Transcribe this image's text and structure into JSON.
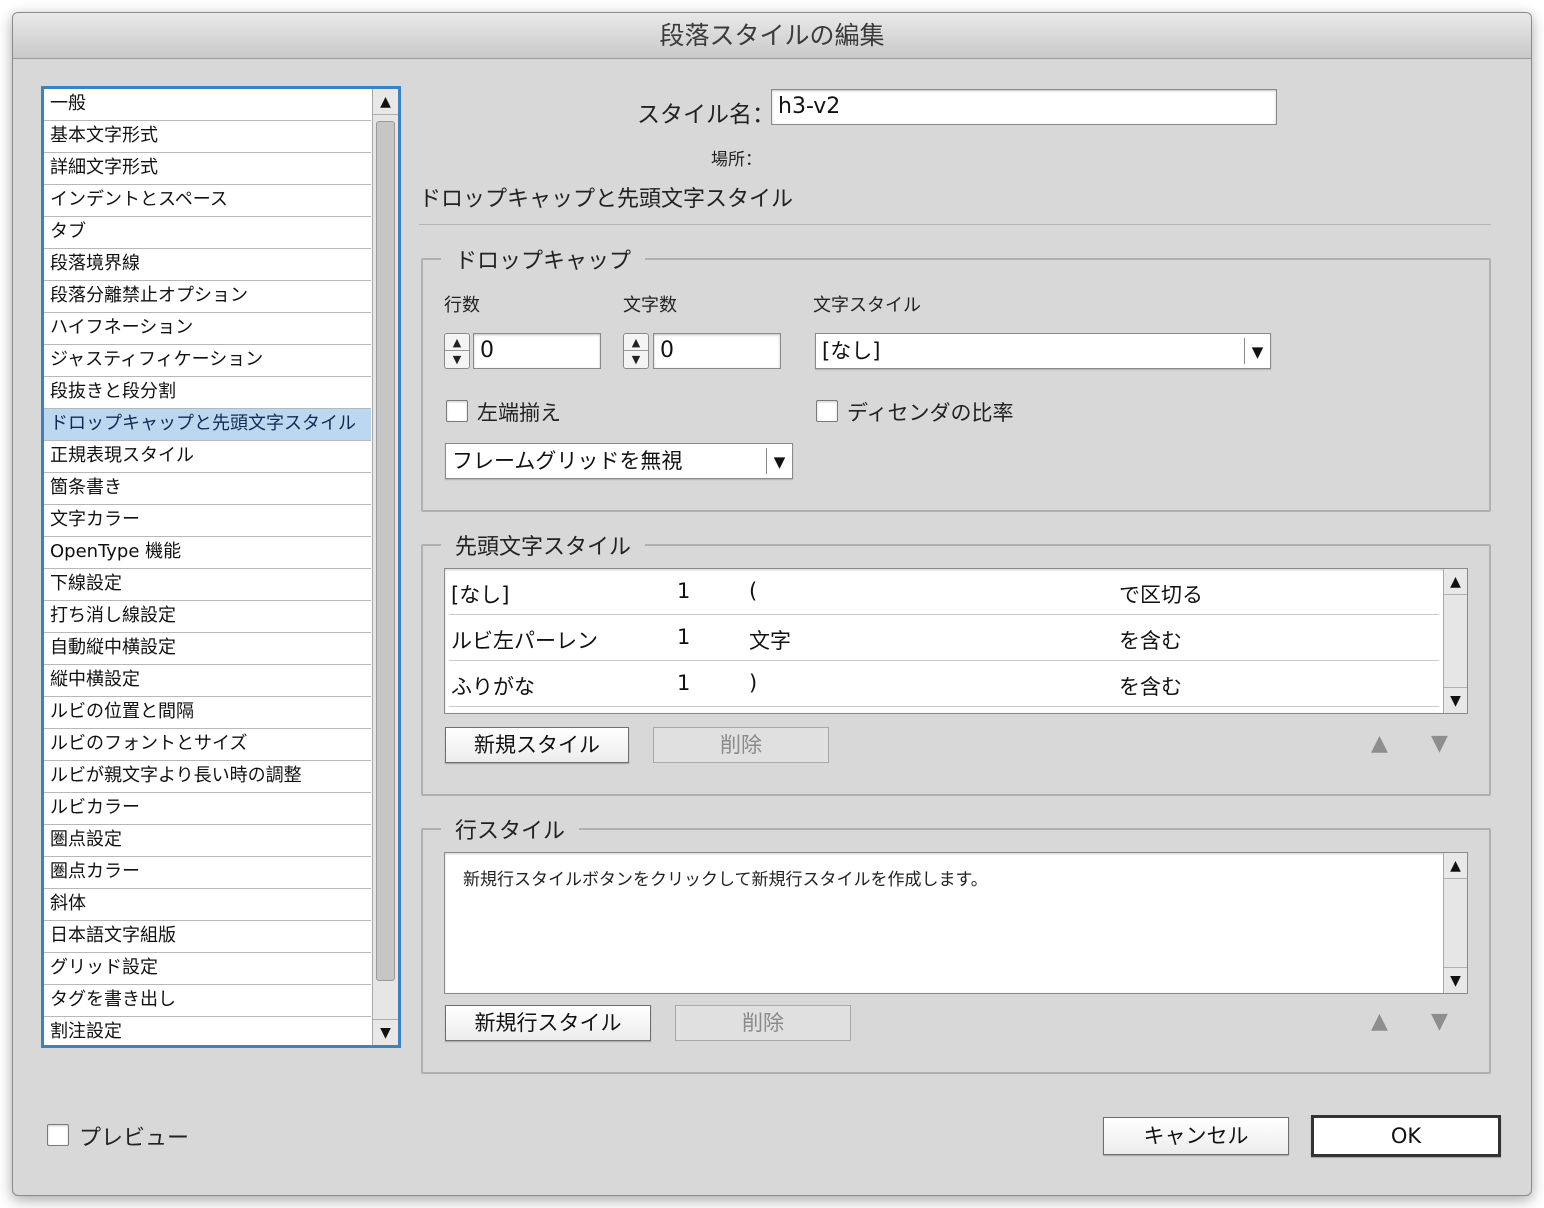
{
  "window": {
    "title": "段落スタイルの編集"
  },
  "categories": [
    "一般",
    "基本文字形式",
    "詳細文字形式",
    "インデントとスペース",
    "タブ",
    "段落境界線",
    "段落分離禁止オプション",
    "ハイフネーション",
    "ジャスティフィケーション",
    "段抜きと段分割",
    "ドロップキャップと先頭文字スタイル",
    "正規表現スタイル",
    "箇条書き",
    "文字カラー",
    "OpenType 機能",
    "下線設定",
    "打ち消し線設定",
    "自動縦中横設定",
    "縦中横設定",
    "ルビの位置と間隔",
    "ルビのフォントとサイズ",
    "ルビが親文字より長い時の調整",
    "ルビカラー",
    "圏点設定",
    "圏点カラー",
    "斜体",
    "日本語文字組版",
    "グリッド設定",
    "タグを書き出し",
    "割注設定"
  ],
  "selected_category": "ドロップキャップと先頭文字スタイル",
  "style_name": {
    "label": "スタイル名：",
    "value": "h3-v2"
  },
  "location": {
    "label": "場所："
  },
  "section_heading": "ドロップキャップと先頭文字スタイル",
  "drop_cap": {
    "group_title": "ドロップキャップ",
    "lines_label": "行数",
    "lines_value": "0",
    "chars_label": "文字数",
    "chars_value": "0",
    "char_style_label": "文字スタイル",
    "char_style_value": "[なし]",
    "align_left_label": "左端揃え",
    "descender_label": "ディセンダの比率",
    "frame_grid_value": "フレームグリッドを無視"
  },
  "nested_styles": {
    "group_title": "先頭文字スタイル",
    "rows": [
      {
        "style": "[なし]",
        "count": "1",
        "item": "(",
        "mode": "で区切る"
      },
      {
        "style": "ルビ左パーレン",
        "count": "1",
        "item": "文字",
        "mode": "を含む"
      },
      {
        "style": "ふりがな",
        "count": "1",
        "item": ")",
        "mode": "を含む"
      }
    ],
    "new_button": "新規スタイル",
    "delete_button": "削除"
  },
  "line_styles": {
    "group_title": "行スタイル",
    "placeholder": "新規行スタイルボタンをクリックして新規行スタイルを作成します。",
    "new_button": "新規行スタイル",
    "delete_button": "削除"
  },
  "footer": {
    "preview_label": "プレビュー",
    "cancel_button": "キャンセル",
    "ok_button": "OK"
  }
}
